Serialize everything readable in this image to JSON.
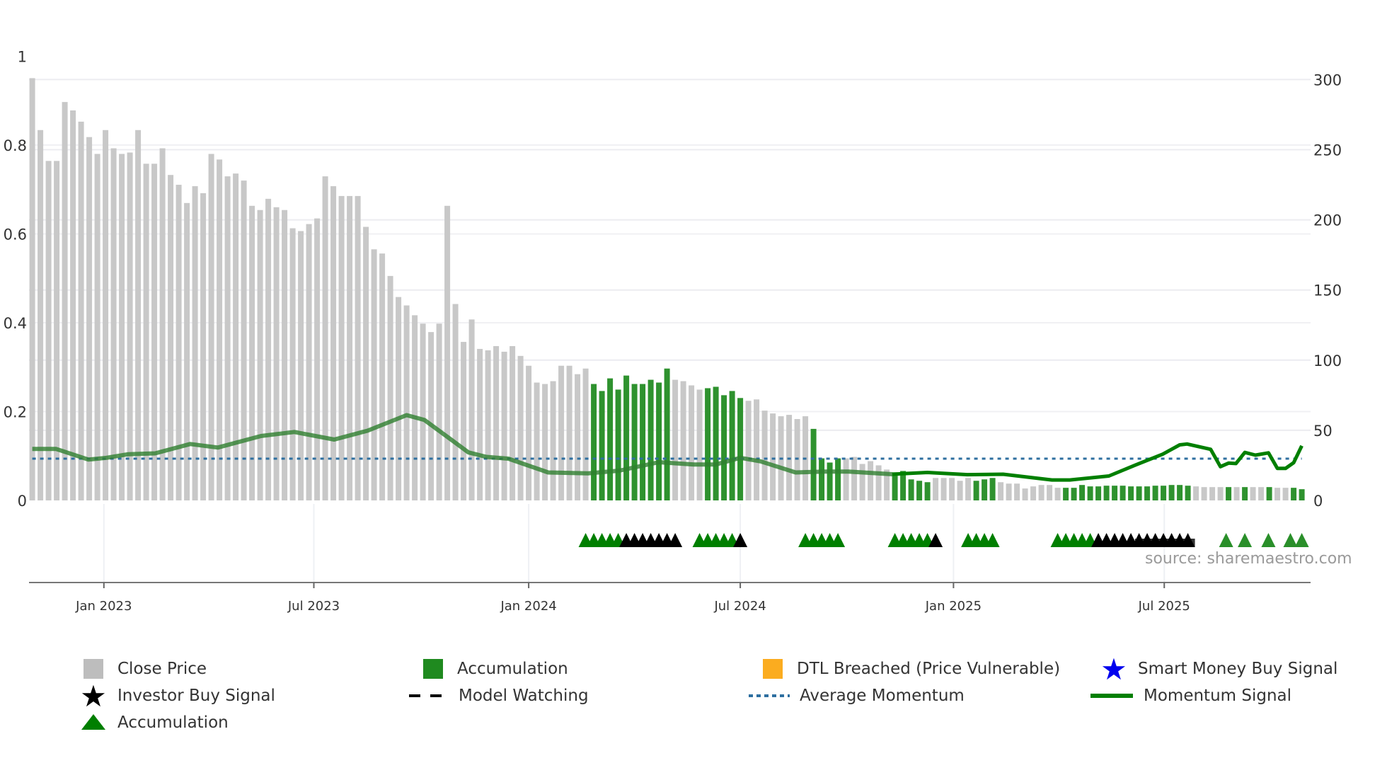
{
  "chart_data": {
    "type": "bar",
    "title": "",
    "x_ticks": [
      "Jan 2023",
      "Jul 2023",
      "Jan 2024",
      "Jul 2024",
      "Jan 2025",
      "Jul 2025"
    ],
    "x_tick_bar_index": [
      9.8,
      35.6,
      62,
      88,
      114.2,
      140.1
    ],
    "left_axis": {
      "ticks": [
        "0",
        "0.2",
        "0.4",
        "0.6",
        "0.8",
        "1"
      ],
      "range": [
        0,
        1
      ]
    },
    "right_axis": {
      "ticks": [
        "0",
        "50",
        "100",
        "150",
        "200",
        "250",
        "300"
      ],
      "range": [
        0,
        300
      ]
    },
    "close_price": [
      301,
      264,
      242,
      242,
      284,
      278,
      270,
      259,
      247,
      264,
      251,
      247,
      248,
      264,
      240,
      240,
      251,
      232,
      225,
      212,
      224,
      219,
      247,
      243,
      231,
      233,
      228,
      210,
      207,
      215,
      209,
      207,
      194,
      192,
      197,
      201,
      231,
      224,
      217,
      217,
      217,
      195,
      179,
      176,
      160,
      145,
      139,
      132,
      126,
      120,
      126,
      210,
      140,
      113,
      129,
      108,
      107,
      110,
      106,
      110,
      103,
      96,
      84,
      83,
      85,
      96,
      96,
      90,
      94,
      83,
      78,
      87,
      79,
      89,
      83,
      83,
      86,
      84,
      94,
      86,
      85,
      82,
      79,
      80,
      81,
      75,
      78,
      73,
      71,
      72,
      64,
      62,
      60,
      61,
      58,
      60,
      51,
      30,
      27,
      30,
      30,
      31,
      26,
      28,
      25,
      22,
      20,
      21,
      15,
      14,
      13,
      16,
      16,
      16,
      14,
      16,
      14,
      15,
      16,
      13,
      12,
      12,
      8.5,
      10,
      11,
      11,
      9,
      9,
      9,
      11,
      10,
      10,
      10.5,
      10.5,
      10.5,
      10,
      10,
      10,
      10.5,
      10.5,
      11,
      11,
      10.5,
      10,
      9.5,
      9.5,
      9.5,
      9.5,
      9.5,
      9.5,
      9.5,
      9.5,
      9.5,
      9,
      9,
      9,
      8
    ],
    "accumulation_bar_indices": [
      70,
      71,
      72,
      73,
      74,
      75,
      76,
      77,
      78,
      79,
      84,
      85,
      86,
      87,
      88,
      97,
      98,
      99,
      100,
      107,
      108,
      109,
      110,
      111,
      117,
      118,
      119,
      128,
      129,
      130,
      131,
      132,
      133,
      134,
      135,
      136,
      137,
      138,
      139,
      140,
      141,
      142,
      143,
      148,
      150,
      153,
      156,
      157
    ],
    "momentum_signal": {
      "x_bar_index": [
        1,
        3.9,
        7.9,
        10.1,
        12.8,
        16.1,
        20.4,
        23.8,
        29.1,
        33.2,
        38.1,
        42.2,
        47,
        49.2,
        54.6,
        56.8,
        59.5,
        64.4,
        69.3,
        73.1,
        78,
        82.3,
        85,
        88,
        90.5,
        94.8,
        98.5,
        101.3,
        106.7,
        111,
        115.9,
        120.3,
        126.3,
        128.5,
        133.3,
        136.6,
        139.9,
        142,
        142.9,
        145.8,
        147,
        148,
        148.9,
        150,
        151.3,
        152.9,
        154,
        155,
        156,
        157
      ],
      "values": [
        0.116,
        0.116,
        0.092,
        0.096,
        0.104,
        0.106,
        0.127,
        0.119,
        0.145,
        0.154,
        0.137,
        0.157,
        0.192,
        0.181,
        0.108,
        0.098,
        0.094,
        0.063,
        0.061,
        0.067,
        0.086,
        0.081,
        0.081,
        0.096,
        0.088,
        0.063,
        0.065,
        0.065,
        0.059,
        0.063,
        0.058,
        0.059,
        0.046,
        0.046,
        0.055,
        0.08,
        0.104,
        0.125,
        0.127,
        0.115,
        0.076,
        0.084,
        0.083,
        0.108,
        0.102,
        0.107,
        0.072,
        0.072,
        0.085,
        0.123
      ],
      "highlight_from_index": 106.7
    },
    "average_momentum": 0.094,
    "markers": {
      "accumulation_indices": [
        69,
        70,
        71,
        72,
        73,
        83,
        84,
        85,
        86,
        87,
        96,
        97,
        98,
        99,
        100,
        107,
        108,
        109,
        110,
        111,
        116,
        117,
        118,
        119,
        127,
        128,
        129,
        130,
        131,
        147.7,
        150,
        152.9,
        155.6,
        157
      ],
      "model_watching_indices": [
        74,
        75,
        76,
        77,
        78,
        79,
        80,
        88,
        112,
        132,
        133,
        134,
        135,
        136,
        137,
        138,
        139,
        140,
        141,
        142,
        143
      ]
    },
    "colors": {
      "close": "#c8c8c8",
      "accumulation": "#2e922e",
      "momentum": "#007f00",
      "average": "#2e6fa0",
      "dtl": "#fbac1f",
      "smart": "#0000ee"
    }
  },
  "source": "source: sharemaestro.com",
  "legend": [
    {
      "label": "Close Price",
      "icon": "gray-square"
    },
    {
      "label": "Accumulation",
      "icon": "green-square"
    },
    {
      "label": "DTL Breached (Price Vulnerable)",
      "icon": "orange-square"
    },
    {
      "label": "Smart Money Buy Signal",
      "icon": "blue-star"
    },
    {
      "label": "Investor Buy Signal",
      "icon": "black-star"
    },
    {
      "label": "Model Watching",
      "icon": "dashed-line"
    },
    {
      "label": "Average Momentum",
      "icon": "dotted-line"
    },
    {
      "label": "Momentum Signal",
      "icon": "green-line"
    },
    {
      "label": "Accumulation",
      "icon": "green-triangle"
    }
  ]
}
